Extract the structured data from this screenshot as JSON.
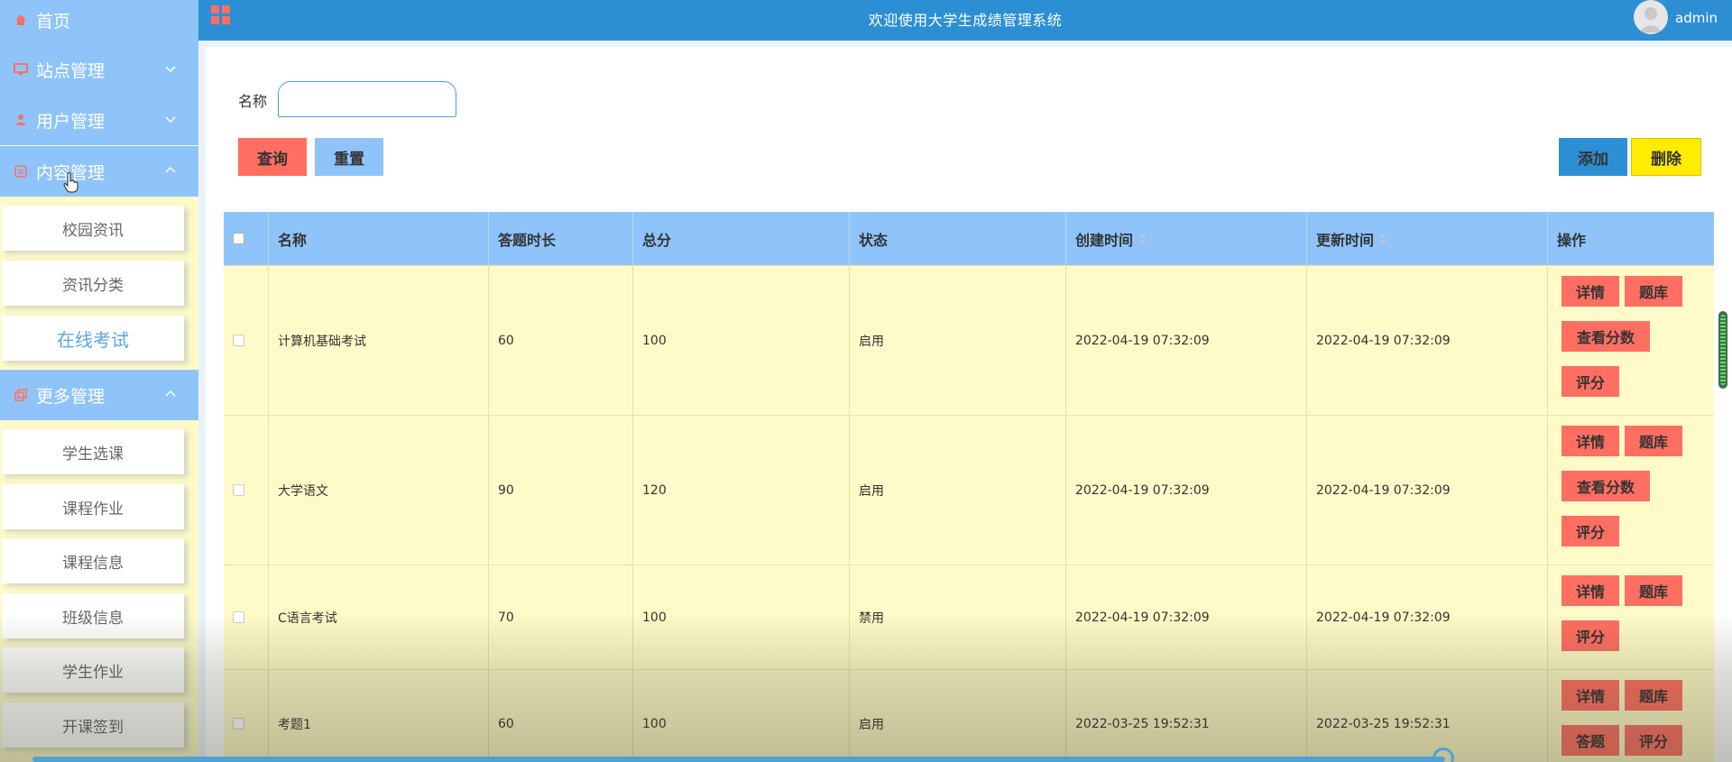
{
  "sidebar": {
    "menus": [
      {
        "label": "首页",
        "icon": "home-icon",
        "has_chevron": false
      },
      {
        "label": "站点管理",
        "icon": "monitor-icon",
        "chevron": "down"
      },
      {
        "label": "用户管理",
        "icon": "user-icon",
        "chevron": "down"
      },
      {
        "label": "内容管理",
        "icon": "message-icon",
        "chevron": "up"
      },
      {
        "label": "更多管理",
        "icon": "copy-icon",
        "chevron": "up"
      }
    ],
    "content_items": [
      "校园资讯",
      "资讯分类",
      "在线考试"
    ],
    "more_items": [
      "学生选课",
      "课程作业",
      "课程信息",
      "班级信息",
      "学生作业",
      "开课签到"
    ]
  },
  "header": {
    "title": "欢迎使用大学生成绩管理系统",
    "username": "admin",
    "colors": {
      "header": "#2d8fd3",
      "accent": "#8fc4fb",
      "row": "#fffbc8",
      "danger": "#ff6f61",
      "warn": "#ffec00"
    }
  },
  "search": {
    "label": "名称",
    "value": "",
    "placeholder": ""
  },
  "toolbar": {
    "query": "查询",
    "reset": "重置",
    "add": "添加",
    "delete": "删除"
  },
  "table": {
    "columns": [
      "名称",
      "答题时长",
      "总分",
      "状态",
      "创建时间",
      "更新时间",
      "操作"
    ],
    "rows": [
      {
        "name": "计算机基础考试",
        "duration": "60",
        "total": "100",
        "status": "启用",
        "created": "2022-04-19 07:32:09",
        "updated": "2022-04-19 07:32:09",
        "ops": [
          "详情",
          "题库",
          "查看分数",
          "评分"
        ]
      },
      {
        "name": "大学语文",
        "duration": "90",
        "total": "120",
        "status": "启用",
        "created": "2022-04-19 07:32:09",
        "updated": "2022-04-19 07:32:09",
        "ops": [
          "详情",
          "题库",
          "查看分数",
          "评分"
        ]
      },
      {
        "name": "C语言考试",
        "duration": "70",
        "total": "100",
        "status": "禁用",
        "created": "2022-04-19 07:32:09",
        "updated": "2022-04-19 07:32:09",
        "ops": [
          "详情",
          "题库",
          "评分"
        ]
      },
      {
        "name": "考题1",
        "duration": "60",
        "total": "100",
        "status": "启用",
        "created": "2022-03-25 19:52:31",
        "updated": "2022-03-25 19:52:31",
        "ops": [
          "详情",
          "题库",
          "答题",
          "评分"
        ]
      }
    ]
  }
}
